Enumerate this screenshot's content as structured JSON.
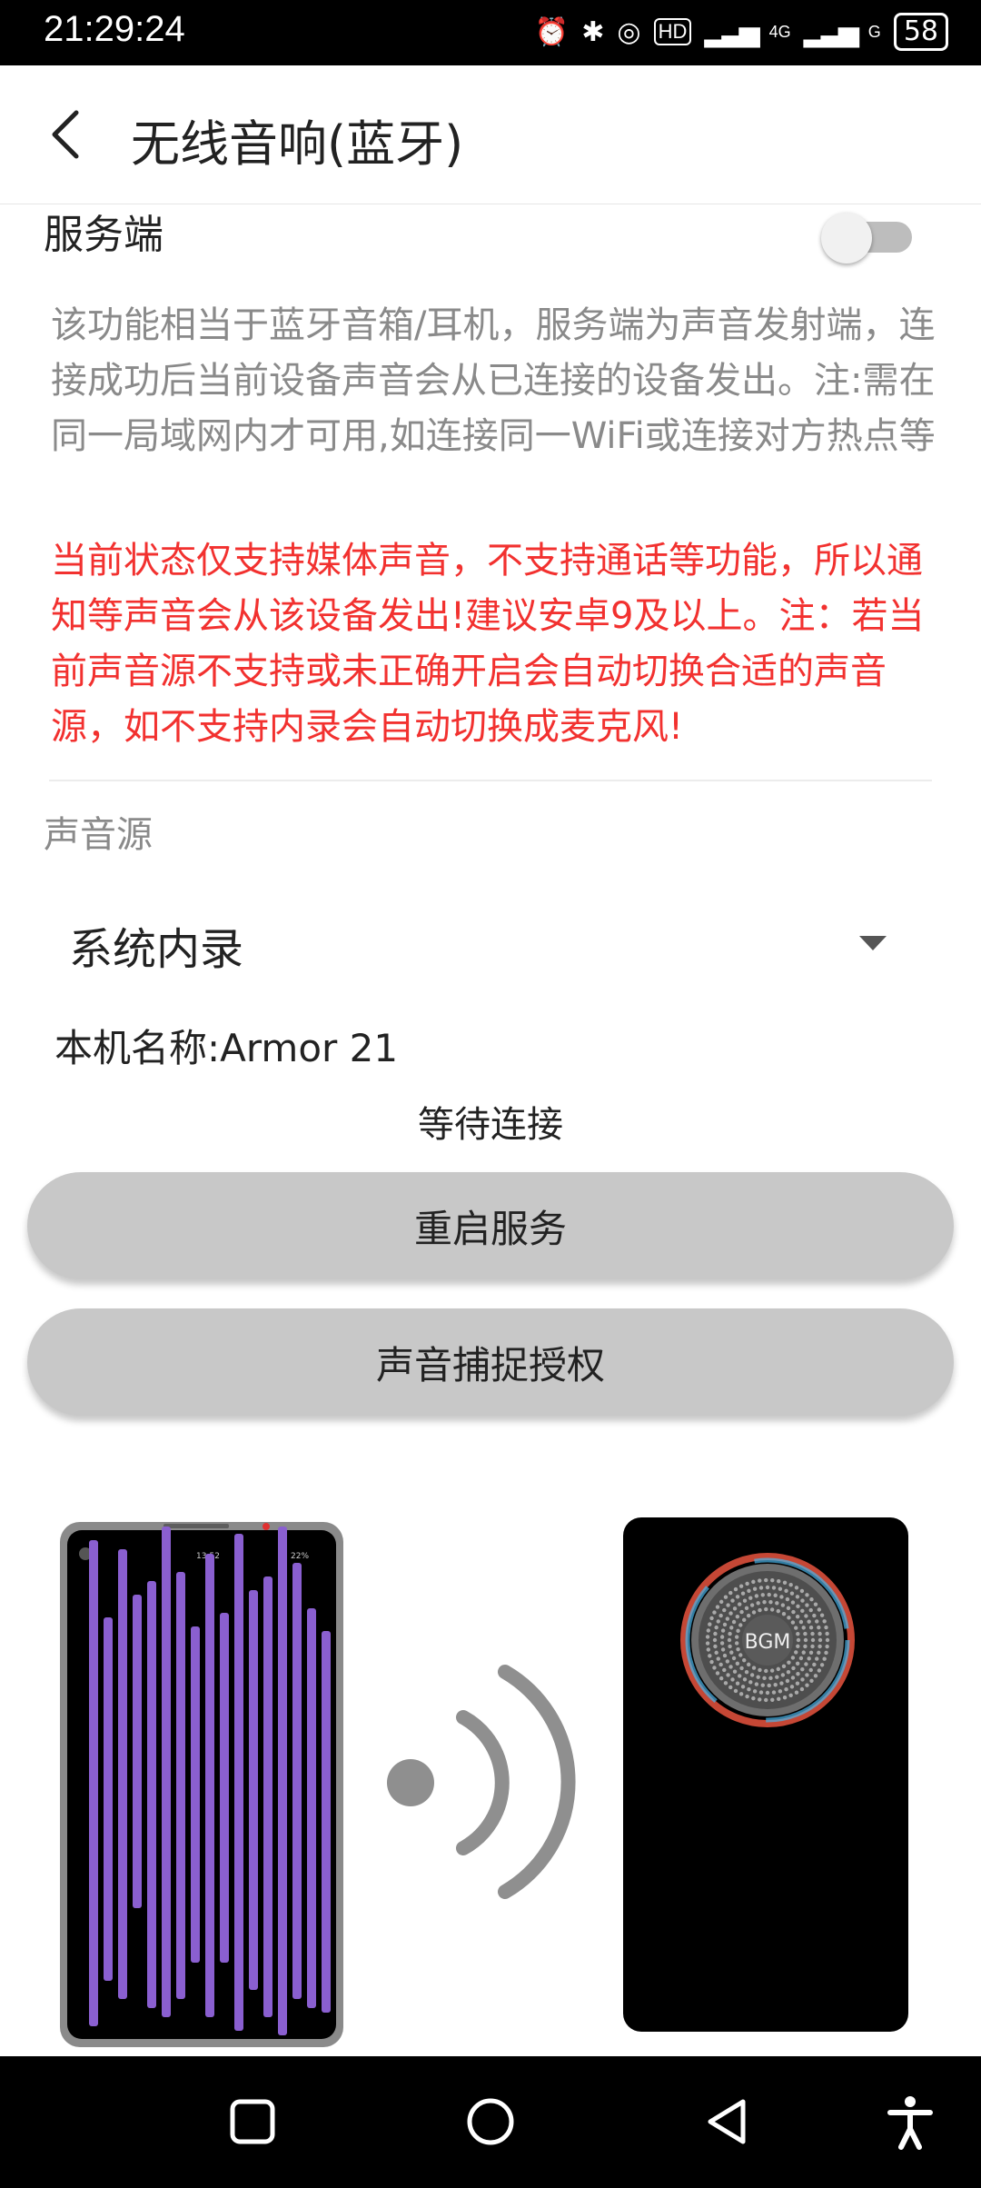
{
  "status_bar": {
    "time": "21:29:24",
    "icons": [
      "alarm-icon",
      "bluetooth-icon",
      "hotspot-icon",
      "hd-icon",
      "signal-icon",
      "signal-icon"
    ],
    "hd": "HD",
    "net1": "4G",
    "net2": "G",
    "battery": "58"
  },
  "header": {
    "title": "无线音响(蓝牙)"
  },
  "server": {
    "label": "服务端",
    "enabled": false
  },
  "description": "该功能相当于蓝牙音箱/耳机，服务端为声音发射端，连接成功后当前设备声音会从已连接的设备发出。注:需在同一局域网内才可用,如连接同一WiFi或连接对方热点等",
  "warning": "当前状态仅支持媒体声音，不支持通话等功能，所以通知等声音会从该设备发出!建议安卓9及以上。注：若当前声音源不支持或未正确开启会自动切换合适的声音源，如不支持内录会自动切换成麦克风!",
  "source": {
    "label": "声音源",
    "selected": "系统内录"
  },
  "device": {
    "name": "本机名称:Armor 21",
    "status": "等待连接"
  },
  "buttons": {
    "restart": "重启服务",
    "capture": "声音捕捉授权"
  },
  "illustration": {
    "phone_status_time": "13:52",
    "phone_battery": "22%",
    "speaker_label": "BGM",
    "colors": {
      "bars": "#8a5fd0",
      "frame": "#8a8a8a",
      "wave": "#8f8f8f"
    }
  },
  "nav": {
    "icons": [
      "recents-icon",
      "home-icon",
      "back-icon",
      "accessibility-icon"
    ]
  },
  "colors": {
    "warning": "#f2312f",
    "secondary_text": "#8a8a8a",
    "button": "#c8c8c8"
  }
}
